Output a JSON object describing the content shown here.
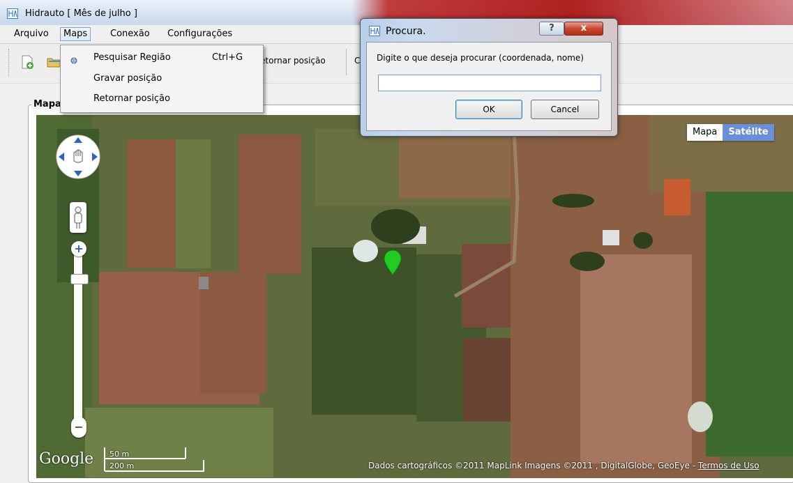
{
  "window": {
    "title": "Hidrauto [ Mês de julho ]",
    "icon": "app-icon"
  },
  "menubar": {
    "items": [
      "Arquivo",
      "Maps",
      "Conexão",
      "Configurações"
    ],
    "active": "Maps"
  },
  "toolbar": {
    "retornar_label": "etornar posição",
    "icons": [
      "new-document-icon",
      "open-folder-icon"
    ]
  },
  "maps_menu": {
    "items": [
      {
        "label": "Pesquisar Região",
        "shortcut": "Ctrl+G",
        "icon": "search-globe-icon"
      },
      {
        "label": "Gravar posição",
        "shortcut": ""
      },
      {
        "label": "Retornar posição",
        "shortcut": ""
      }
    ]
  },
  "panel": {
    "label": "Mapa"
  },
  "map": {
    "type_buttons": {
      "map": "Mapa",
      "satellite": "Satélite",
      "selected": "Satélite"
    },
    "logo": "Google",
    "scale": {
      "top": "50 m",
      "bottom": "200 m"
    },
    "copyright": "Dados cartográficos ©2011 MapLink Imagens ©2011 , DigitalGlobe, GeoEye -",
    "terms": "Termos de Uso",
    "marker_color": "#22cc22",
    "zoom_level": 0.18
  },
  "dialog": {
    "title": "Procura.",
    "help": "?",
    "close": "x",
    "prompt": "Digite o que deseja procurar (coordenada, nome)",
    "input_value": "",
    "ok": "OK",
    "cancel": "Cancel"
  },
  "colors": {
    "titlebar_blue": "#d6e3f1",
    "satellite_selected": "#6b8ed8",
    "close_red": "#c84a33"
  }
}
